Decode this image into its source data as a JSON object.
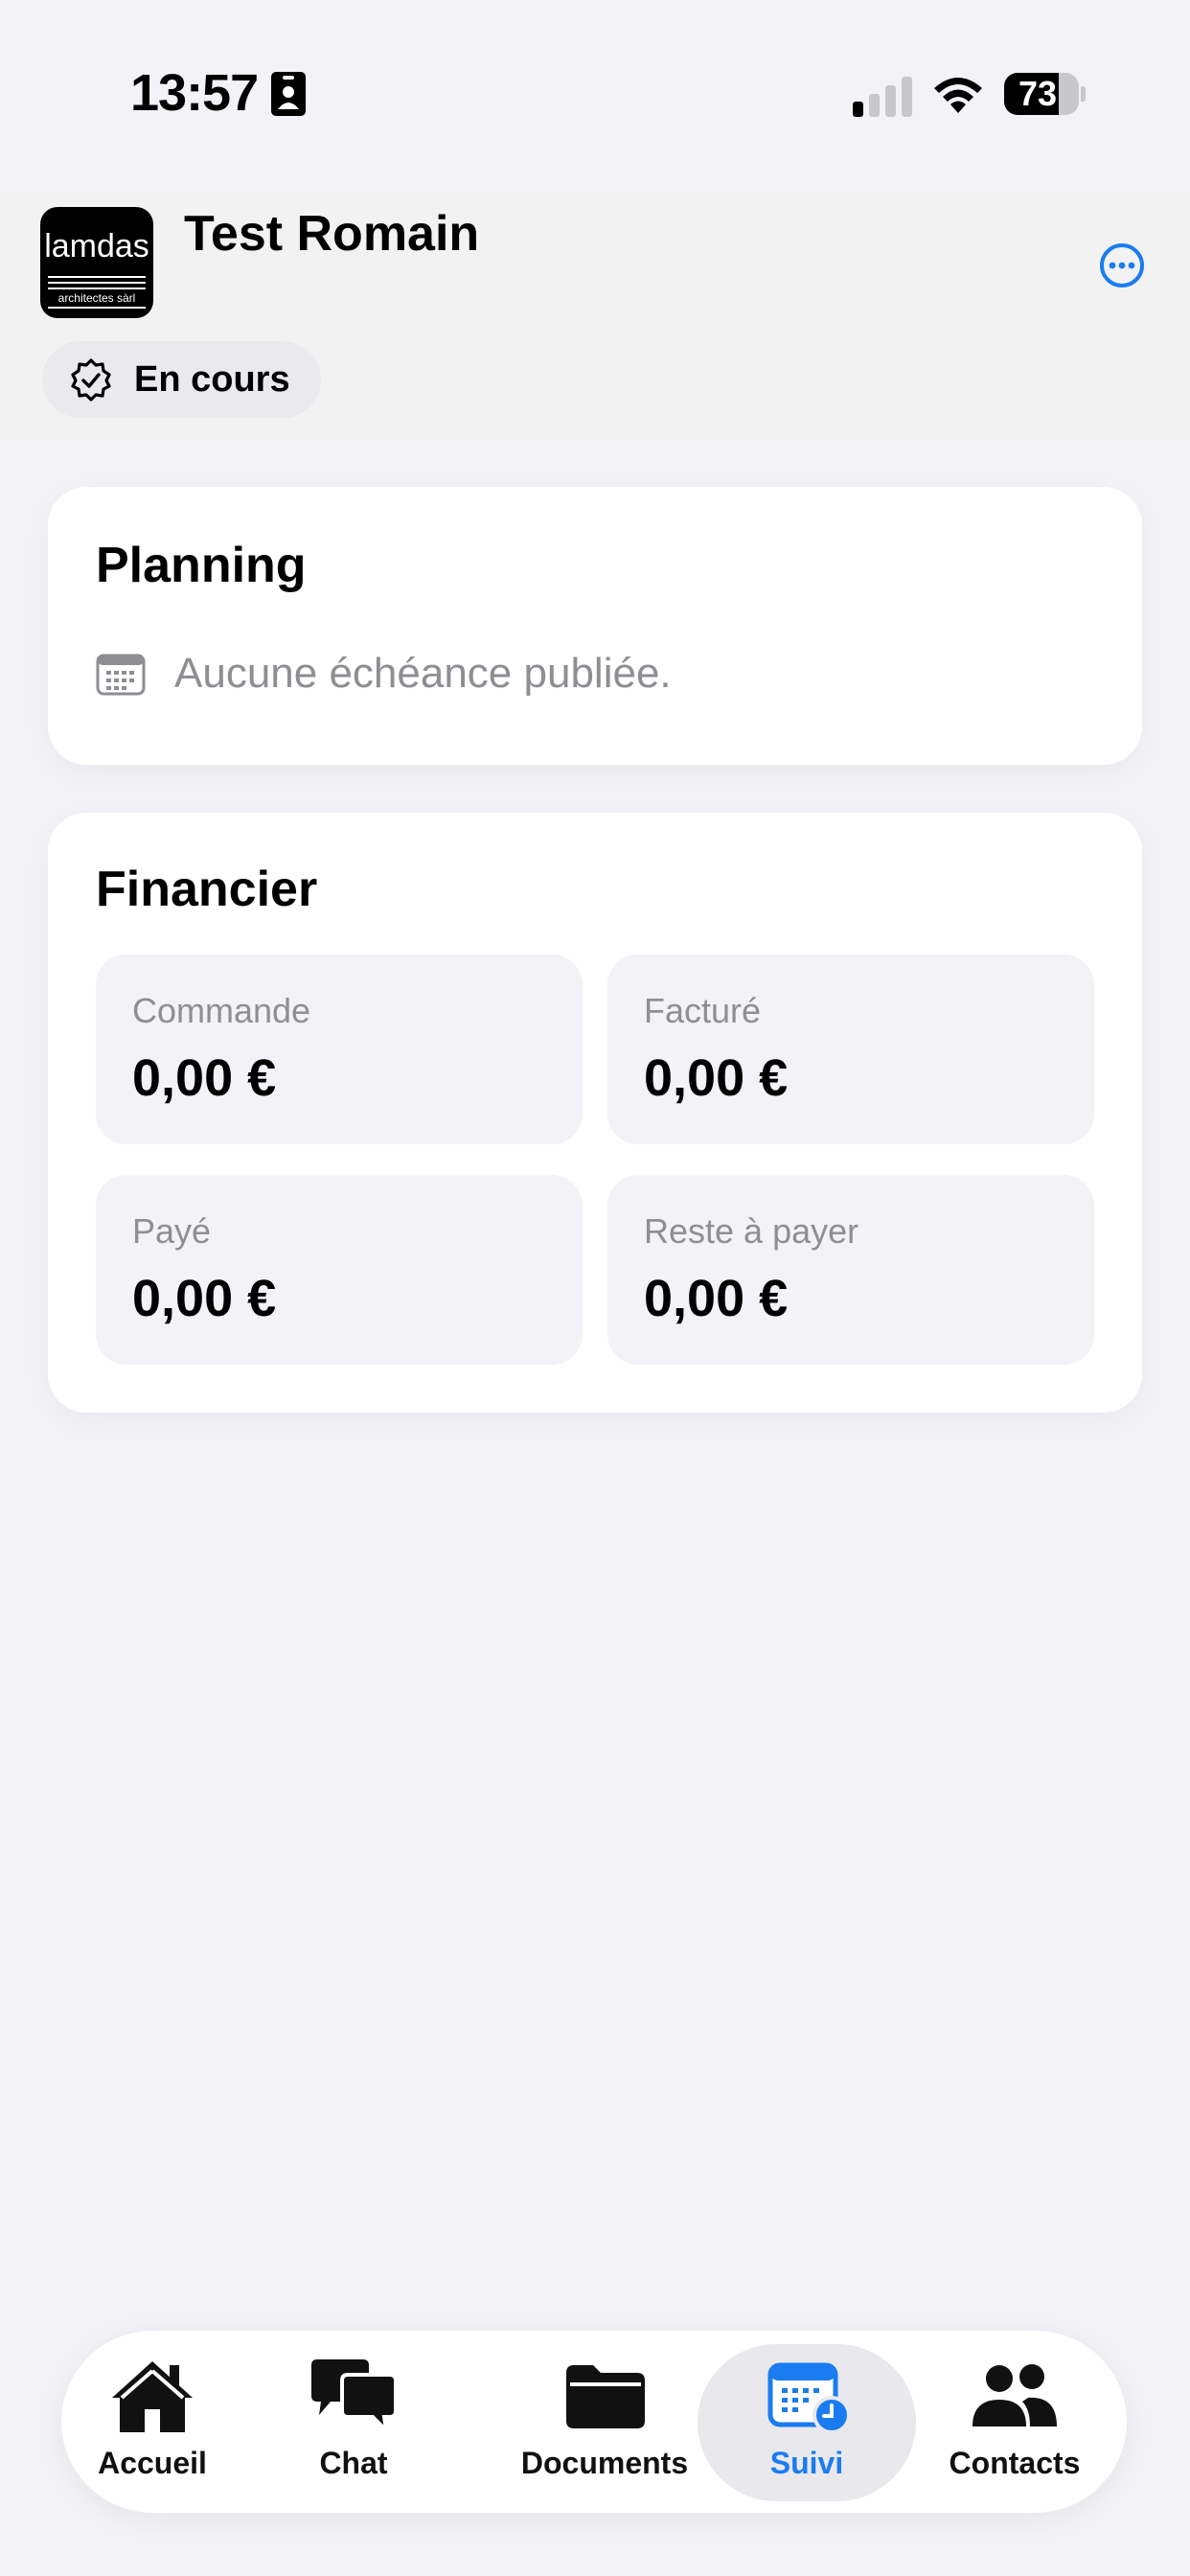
{
  "status_bar": {
    "time": "13:57",
    "battery": "73",
    "battery_level": 0.73,
    "icons": [
      "id-card-icon",
      "signal-icon",
      "wifi-icon",
      "battery-icon"
    ]
  },
  "header": {
    "logo_text": "lamdas",
    "logo_subtext": "architectes sàrl",
    "title": "Test Romain",
    "status_label": "En cours",
    "more_icon": "ellipsis-circle-icon",
    "accent_color": "#1a7cf0"
  },
  "planning": {
    "title": "Planning",
    "empty_text": "Aucune échéance publiée."
  },
  "financier": {
    "title": "Financier",
    "tiles": [
      {
        "label": "Commande",
        "value": "0,00 €"
      },
      {
        "label": "Facturé",
        "value": "0,00 €"
      },
      {
        "label": "Payé",
        "value": "0,00 €"
      },
      {
        "label": "Reste à payer",
        "value": "0,00 €"
      }
    ]
  },
  "tabbar": {
    "active": "Suivi",
    "tabs": [
      {
        "label": "Accueil",
        "icon": "house-icon"
      },
      {
        "label": "Chat",
        "icon": "chat-bubbles-icon"
      },
      {
        "label": "Documents",
        "icon": "folder-icon"
      },
      {
        "label": "Suivi",
        "icon": "calendar-clock-icon"
      },
      {
        "label": "Contacts",
        "icon": "people-icon"
      }
    ]
  }
}
